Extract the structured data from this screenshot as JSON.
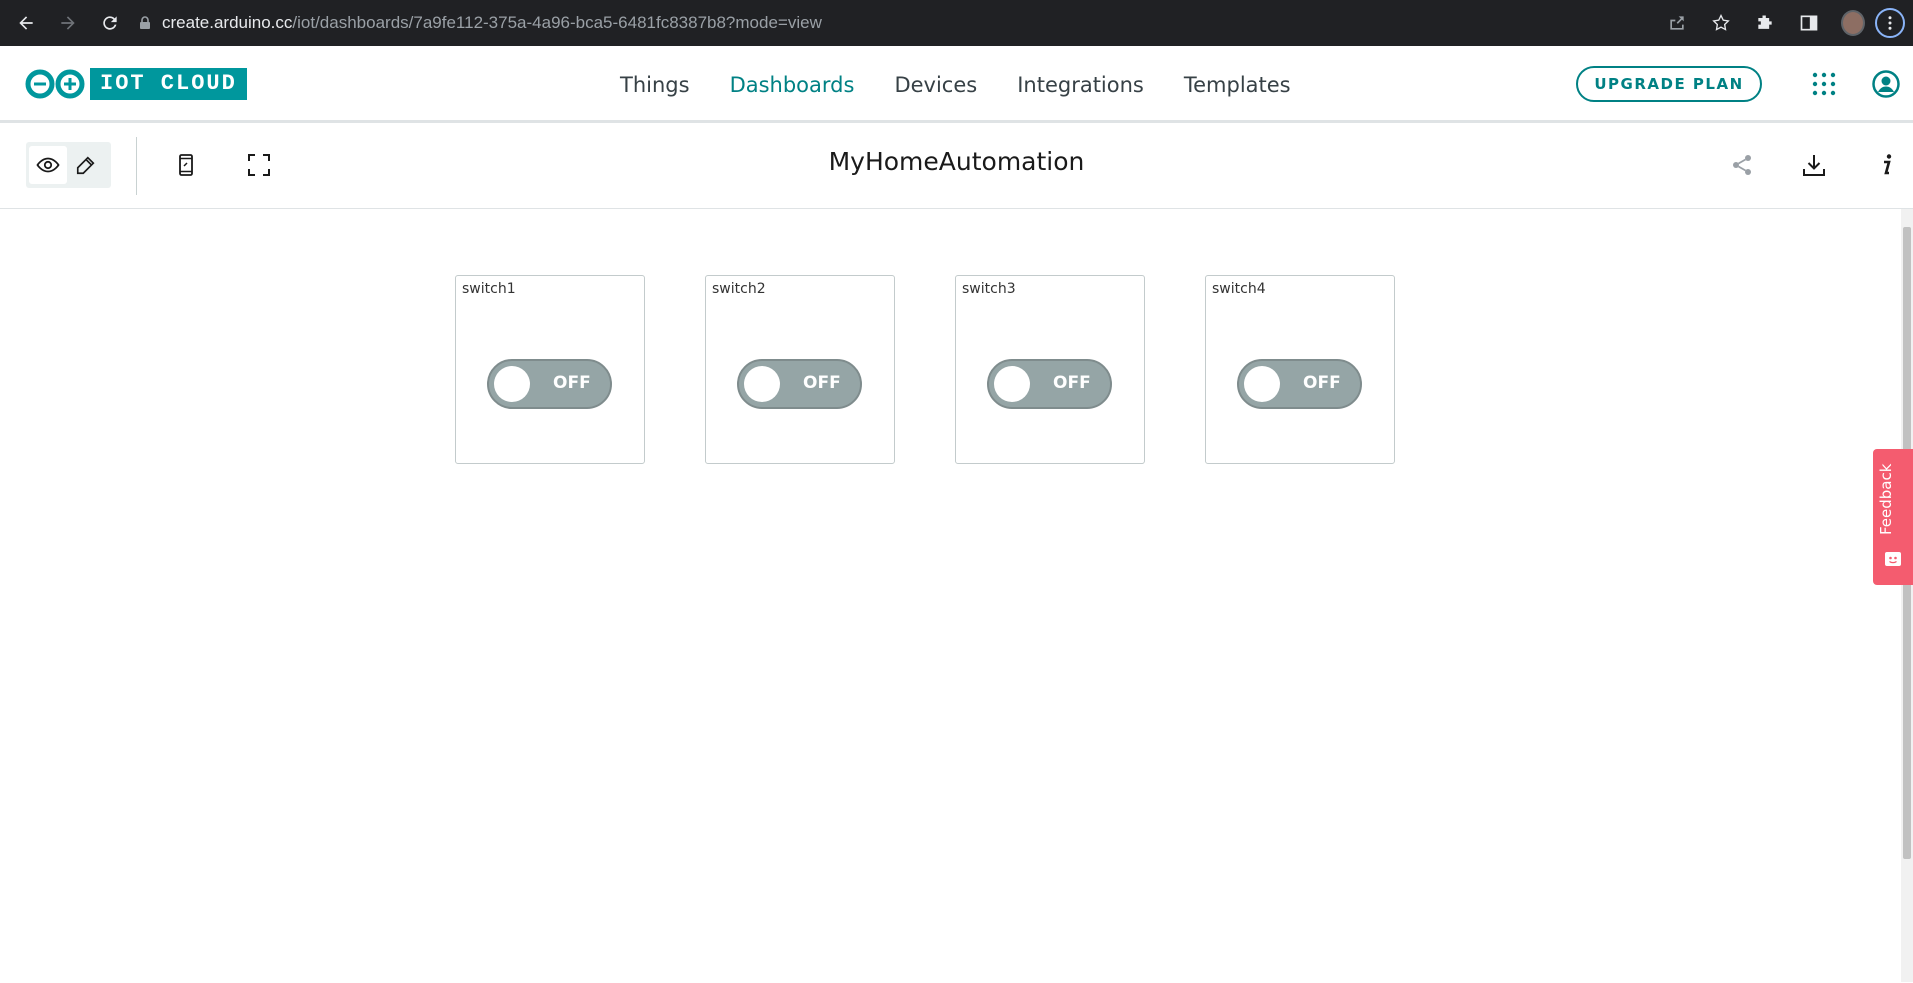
{
  "browser": {
    "url_domain": "create.arduino.cc",
    "url_path": "/iot/dashboards/7a9fe112-375a-4a96-bca5-6481fc8387b8?mode=view"
  },
  "header": {
    "logo_text": "IOT CLOUD",
    "nav": [
      {
        "label": "Things",
        "active": false
      },
      {
        "label": "Dashboards",
        "active": true
      },
      {
        "label": "Devices",
        "active": false
      },
      {
        "label": "Integrations",
        "active": false
      },
      {
        "label": "Templates",
        "active": false
      }
    ],
    "upgrade_label": "UPGRADE PLAN"
  },
  "toolbar": {
    "title": "MyHomeAutomation",
    "mode": "view"
  },
  "widgets": [
    {
      "title": "switch1",
      "state": "OFF"
    },
    {
      "title": "switch2",
      "state": "OFF"
    },
    {
      "title": "switch3",
      "state": "OFF"
    },
    {
      "title": "switch4",
      "state": "OFF"
    }
  ],
  "feedback_label": "Feedback",
  "colors": {
    "accent": "#008184",
    "brand": "#00979d",
    "switch_off": "#95a5a6",
    "feedback": "#f45c6f"
  }
}
